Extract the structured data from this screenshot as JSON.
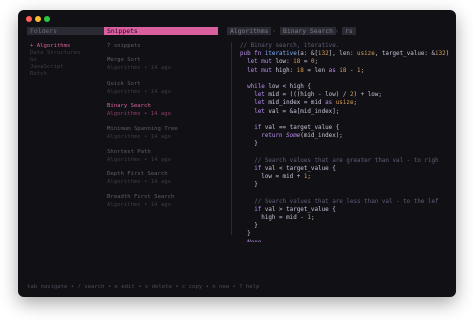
{
  "panes": {
    "folders_label": "Folders",
    "snippets_label": "Snippets"
  },
  "folders": [
    {
      "label": "+ Algorithms",
      "state": "active"
    },
    {
      "label": "Data Structures",
      "state": "dim"
    },
    {
      "label": "Go",
      "state": "dim"
    },
    {
      "label": "JavaScript",
      "state": "dim"
    },
    {
      "label": "Ratch",
      "state": "dim"
    }
  ],
  "snippet_count": "7 snippets",
  "snippets": [
    {
      "title": "Merge Sort",
      "meta": "Algorithms • 14 ago",
      "selected": false
    },
    {
      "title": "Quick Sort",
      "meta": "Algorithms • 14 ago",
      "selected": false
    },
    {
      "title": "Binary Search",
      "meta": "Algorithms • 14 ago",
      "selected": true
    },
    {
      "title": "Minimum Spanning Tree",
      "meta": "Algorithms • 14 ago",
      "selected": false
    },
    {
      "title": "Shortest Path",
      "meta": "Algorithms • 14 ago",
      "selected": false
    },
    {
      "title": "Depth First Search",
      "meta": "Algorithms • 14 ago",
      "selected": false
    },
    {
      "title": "Breadth First Search",
      "meta": "Algorithms • 14 ago",
      "selected": false
    }
  ],
  "breadcrumb": {
    "folder": "Algorithms",
    "snippet": "Binary Search",
    "language": "rs"
  },
  "code_lines": [
    {
      "indent": 0,
      "tokens": [
        [
          "c",
          "// Binary search, iterative."
        ]
      ]
    },
    {
      "indent": 0,
      "tokens": [
        [
          "k",
          "pub fn "
        ],
        [
          "f",
          "iterative"
        ],
        [
          "p",
          "(a: &["
        ],
        [
          "t",
          "i32"
        ],
        [
          "p",
          "], len: "
        ],
        [
          "t",
          "usize"
        ],
        [
          "p",
          ", target_value: &"
        ],
        [
          "t",
          "i32"
        ],
        [
          "p",
          ")"
        ]
      ]
    },
    {
      "indent": 2,
      "tokens": [
        [
          "k",
          "let mut "
        ],
        [
          "v",
          "low"
        ],
        [
          "p",
          ": "
        ],
        [
          "t",
          "i8"
        ],
        [
          "p",
          " = "
        ],
        [
          "n",
          "0"
        ],
        [
          "p",
          ";"
        ]
      ]
    },
    {
      "indent": 2,
      "tokens": [
        [
          "k",
          "let mut "
        ],
        [
          "v",
          "high"
        ],
        [
          "p",
          ": "
        ],
        [
          "t",
          "i8"
        ],
        [
          "p",
          " = len "
        ],
        [
          "k",
          "as "
        ],
        [
          "t",
          "i8"
        ],
        [
          "p",
          " - "
        ],
        [
          "n",
          "1"
        ],
        [
          "p",
          ";"
        ]
      ]
    },
    {
      "indent": 0,
      "tokens": []
    },
    {
      "indent": 2,
      "tokens": [
        [
          "k",
          "while "
        ],
        [
          "p",
          "low < high {"
        ]
      ]
    },
    {
      "indent": 4,
      "tokens": [
        [
          "k",
          "let "
        ],
        [
          "v",
          "mid"
        ],
        [
          "p",
          " = (((high - low) / "
        ],
        [
          "n",
          "2"
        ],
        [
          "p",
          ") + low;"
        ]
      ]
    },
    {
      "indent": 4,
      "tokens": [
        [
          "k",
          "let "
        ],
        [
          "v",
          "mid_index"
        ],
        [
          "p",
          " = mid "
        ],
        [
          "k",
          "as "
        ],
        [
          "t",
          "usize"
        ],
        [
          "p",
          ";"
        ]
      ]
    },
    {
      "indent": 4,
      "tokens": [
        [
          "k",
          "let "
        ],
        [
          "v",
          "val"
        ],
        [
          "p",
          " = &a[mid_index];"
        ]
      ]
    },
    {
      "indent": 0,
      "tokens": []
    },
    {
      "indent": 4,
      "tokens": [
        [
          "k",
          "if "
        ],
        [
          "p",
          "val == target_value {"
        ]
      ]
    },
    {
      "indent": 6,
      "tokens": [
        [
          "k",
          "return "
        ],
        [
          "i",
          "Some"
        ],
        [
          "p",
          "(mid_index);"
        ]
      ]
    },
    {
      "indent": 4,
      "tokens": [
        [
          "p",
          "}"
        ]
      ]
    },
    {
      "indent": 0,
      "tokens": []
    },
    {
      "indent": 4,
      "tokens": [
        [
          "c",
          "// Search values that are greater than val - to righ"
        ]
      ]
    },
    {
      "indent": 4,
      "tokens": [
        [
          "k",
          "if "
        ],
        [
          "p",
          "val < target_value {"
        ]
      ]
    },
    {
      "indent": 6,
      "tokens": [
        [
          "p",
          "low = mid + "
        ],
        [
          "n",
          "1"
        ],
        [
          "p",
          ";"
        ]
      ]
    },
    {
      "indent": 4,
      "tokens": [
        [
          "p",
          "}"
        ]
      ]
    },
    {
      "indent": 0,
      "tokens": []
    },
    {
      "indent": 4,
      "tokens": [
        [
          "c",
          "// Search values that are less than val - to the lef"
        ]
      ]
    },
    {
      "indent": 4,
      "tokens": [
        [
          "k",
          "if "
        ],
        [
          "p",
          "val > target_value {"
        ]
      ]
    },
    {
      "indent": 6,
      "tokens": [
        [
          "p",
          "high = mid - "
        ],
        [
          "n",
          "1"
        ],
        [
          "p",
          ";"
        ]
      ]
    },
    {
      "indent": 4,
      "tokens": [
        [
          "p",
          "}"
        ]
      ]
    },
    {
      "indent": 2,
      "tokens": [
        [
          "p",
          "}"
        ]
      ]
    },
    {
      "indent": 2,
      "tokens": [
        [
          "i",
          "None"
        ]
      ]
    },
    {
      "indent": 0,
      "tokens": [
        [
          "p",
          "}"
        ]
      ]
    }
  ],
  "status_bar": "tab navigate • / search • e edit • x delete • c copy • n new • ? help",
  "colors": {
    "accent": "#d960a0",
    "background": "#111014",
    "keyword": "#b98ef0",
    "function": "#7fb0ff",
    "type": "#d8a05a",
    "comment": "#5e5e78"
  }
}
